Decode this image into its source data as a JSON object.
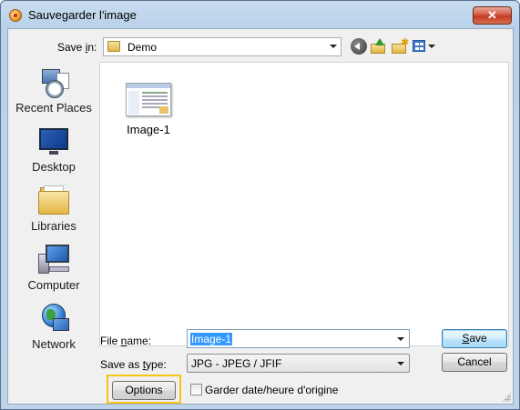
{
  "window": {
    "title": "Sauvegarder l'image",
    "close_glyph": "✕"
  },
  "toolbar": {
    "save_in_label_pre": "Save ",
    "save_in_label_key": "i",
    "save_in_label_post": "n:",
    "save_in_value": "Demo",
    "icons": [
      "back-icon",
      "up-folder-icon",
      "new-folder-icon",
      "views-menu-icon"
    ]
  },
  "places": [
    {
      "label": "Recent Places"
    },
    {
      "label": "Desktop"
    },
    {
      "label": "Libraries"
    },
    {
      "label": "Computer"
    },
    {
      "label": "Network"
    }
  ],
  "files": [
    {
      "label": "Image-1"
    }
  ],
  "form": {
    "file_name_pre": "File ",
    "file_name_key": "n",
    "file_name_post": "ame:",
    "file_name_value": "Image-1",
    "save_as_type_pre": "Save as ",
    "save_as_type_key": "t",
    "save_as_type_post": "ype:",
    "save_as_type_value": "JPG - JPEG / JFIF",
    "save_key": "S",
    "save_rest": "ave",
    "cancel_label": "Cancel",
    "options_label": "Options",
    "keep_date_label": "Garder date/heure d'origine",
    "keep_date_checked": false
  },
  "colors": {
    "highlight_outline": "#f5c518",
    "selection": "#3399ff"
  }
}
